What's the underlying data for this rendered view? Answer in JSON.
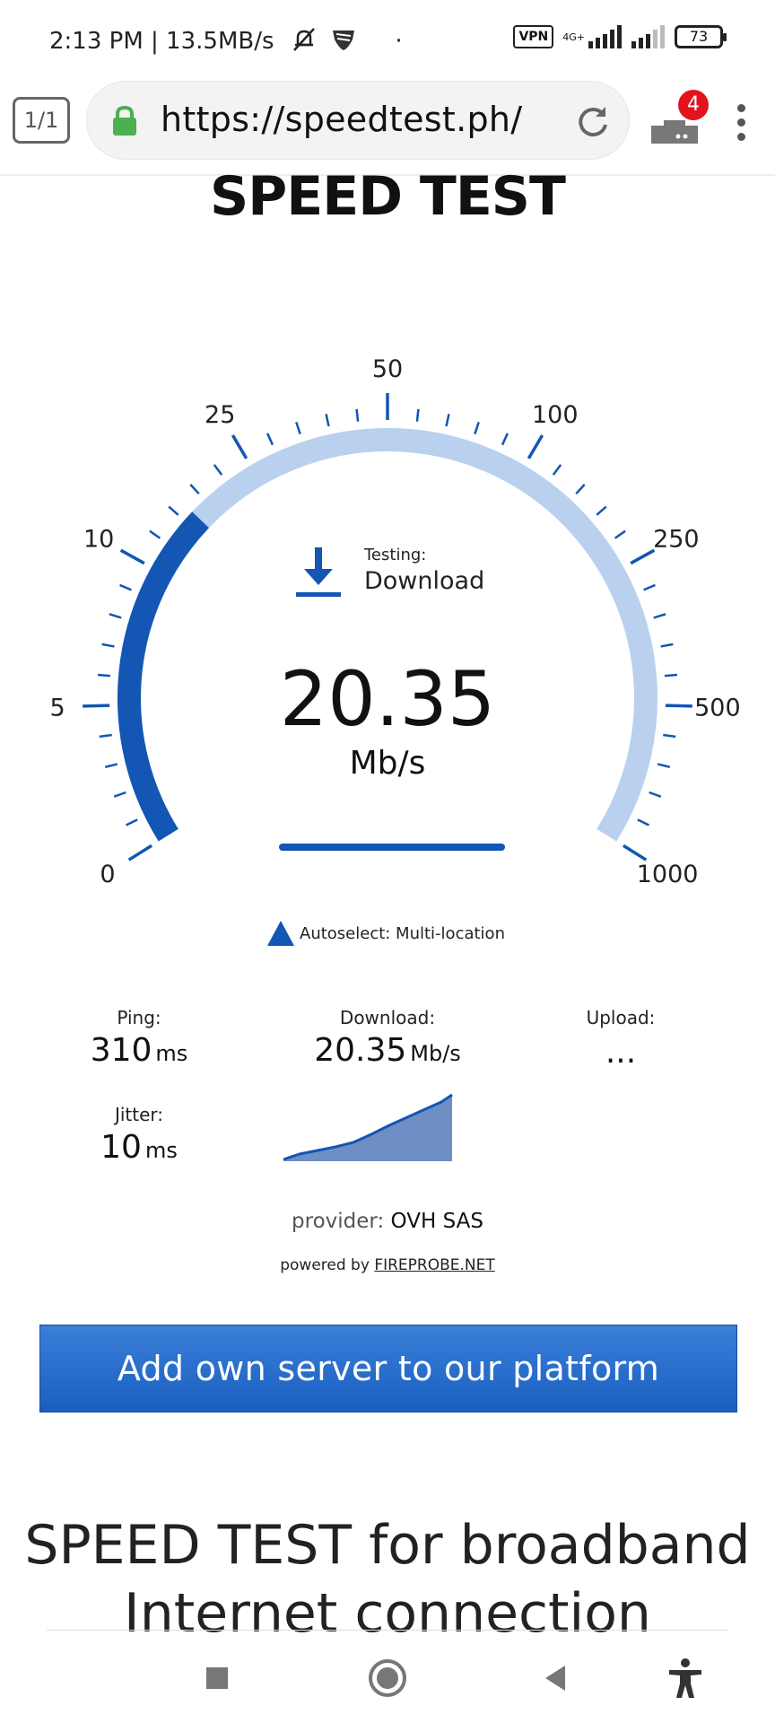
{
  "status_bar": {
    "time_speed": "2:13 PM | 13.5MB/s",
    "dot": "·",
    "vpn": "VPN",
    "network": "4G+",
    "battery": "73"
  },
  "browser": {
    "tab_count": "1/1",
    "url": "https://speedtest.ph/",
    "download_badge": "4"
  },
  "page": {
    "heading": "SPEED TEST",
    "gauge": {
      "scale_labels": [
        "0",
        "5",
        "10",
        "25",
        "50",
        "100",
        "250",
        "500",
        "1000"
      ],
      "progress_fraction": 0.31,
      "track_color": "#b9d0ee",
      "fill_color": "#1356b4"
    },
    "testing_label": "Testing:",
    "testing_value": "Download",
    "speed_value": "20.35",
    "speed_unit": "Mb/s",
    "autoselect": "Autoselect: Multi-location",
    "stats": {
      "ping_label": "Ping:",
      "ping_value": "310",
      "ping_unit": "ms",
      "download_label": "Download:",
      "download_value": "20.35",
      "download_unit": "Mb/s",
      "upload_label": "Upload:",
      "upload_value": "...",
      "jitter_label": "Jitter:",
      "jitter_value": "10",
      "jitter_unit": "ms"
    },
    "provider_label": "provider:",
    "provider_value": "OVH SAS",
    "powered_label": "powered by",
    "powered_link": "FIREPROBE.NET",
    "cta_button": "Add own server to our platform",
    "section_heading_line1": "SPEED TEST for broadband",
    "section_heading_line2": "Internet connection"
  },
  "nav": {
    "icons": [
      "recents-icon",
      "home-icon",
      "back-icon",
      "accessibility-icon"
    ]
  }
}
